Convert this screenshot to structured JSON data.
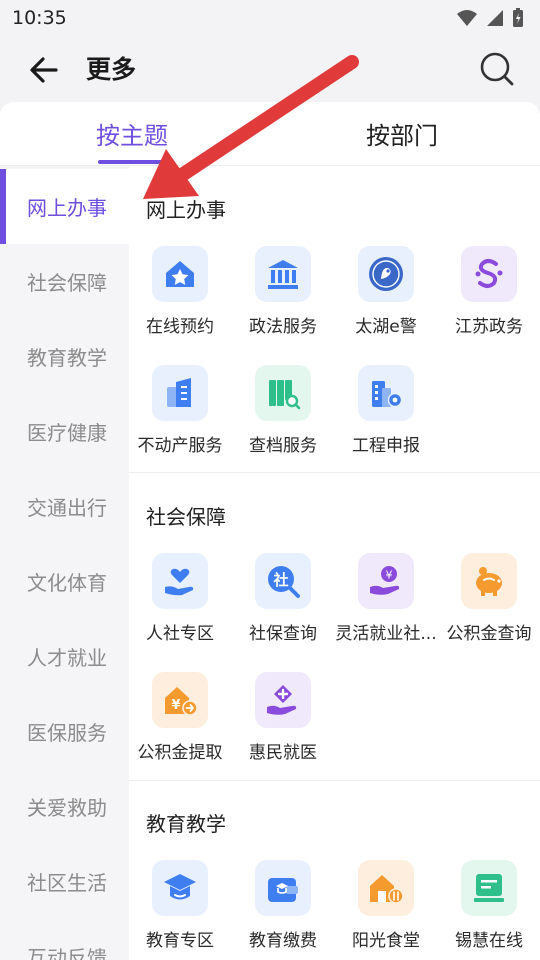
{
  "status_bar": {
    "time": "10:35"
  },
  "header": {
    "title": "更多"
  },
  "tabs": [
    {
      "label": "按主题",
      "active": true
    },
    {
      "label": "按部门",
      "active": false
    }
  ],
  "sidebar": {
    "items": [
      {
        "label": "网上办事",
        "active": true
      },
      {
        "label": "社会保障",
        "active": false
      },
      {
        "label": "教育教学",
        "active": false
      },
      {
        "label": "医疗健康",
        "active": false
      },
      {
        "label": "交通出行",
        "active": false
      },
      {
        "label": "文化体育",
        "active": false
      },
      {
        "label": "人才就业",
        "active": false
      },
      {
        "label": "医保服务",
        "active": false
      },
      {
        "label": "关爱救助",
        "active": false
      },
      {
        "label": "社区生活",
        "active": false
      },
      {
        "label": "互动反馈",
        "active": false
      }
    ]
  },
  "sections": [
    {
      "title": "网上办事",
      "items": [
        {
          "label": "在线预约",
          "icon": "house-star-icon"
        },
        {
          "label": "政法服务",
          "icon": "government-building-icon"
        },
        {
          "label": "太湖e警",
          "icon": "police-badge-icon"
        },
        {
          "label": "江苏政务",
          "icon": "jiangsu-logo-icon"
        },
        {
          "label": "不动产服务",
          "icon": "buildings-icon"
        },
        {
          "label": "查档服务",
          "icon": "archive-search-icon"
        },
        {
          "label": "工程申报",
          "icon": "building-gear-icon"
        }
      ]
    },
    {
      "title": "社会保障",
      "items": [
        {
          "label": "人社专区",
          "icon": "heart-hand-icon"
        },
        {
          "label": "社保查询",
          "icon": "social-security-search-icon"
        },
        {
          "label": "灵活就业社...",
          "icon": "coin-hand-icon"
        },
        {
          "label": "公积金查询",
          "icon": "piggy-bank-icon"
        },
        {
          "label": "公积金提取",
          "icon": "house-yuan-icon"
        },
        {
          "label": "惠民就医",
          "icon": "medical-hand-icon"
        }
      ]
    },
    {
      "title": "教育教学",
      "items": [
        {
          "label": "教育专区",
          "icon": "graduation-cap-icon"
        },
        {
          "label": "教育缴费",
          "icon": "wallet-cap-icon"
        },
        {
          "label": "阳光食堂",
          "icon": "house-dining-icon"
        },
        {
          "label": "锡慧在线",
          "icon": "online-screen-icon"
        }
      ]
    }
  ]
}
